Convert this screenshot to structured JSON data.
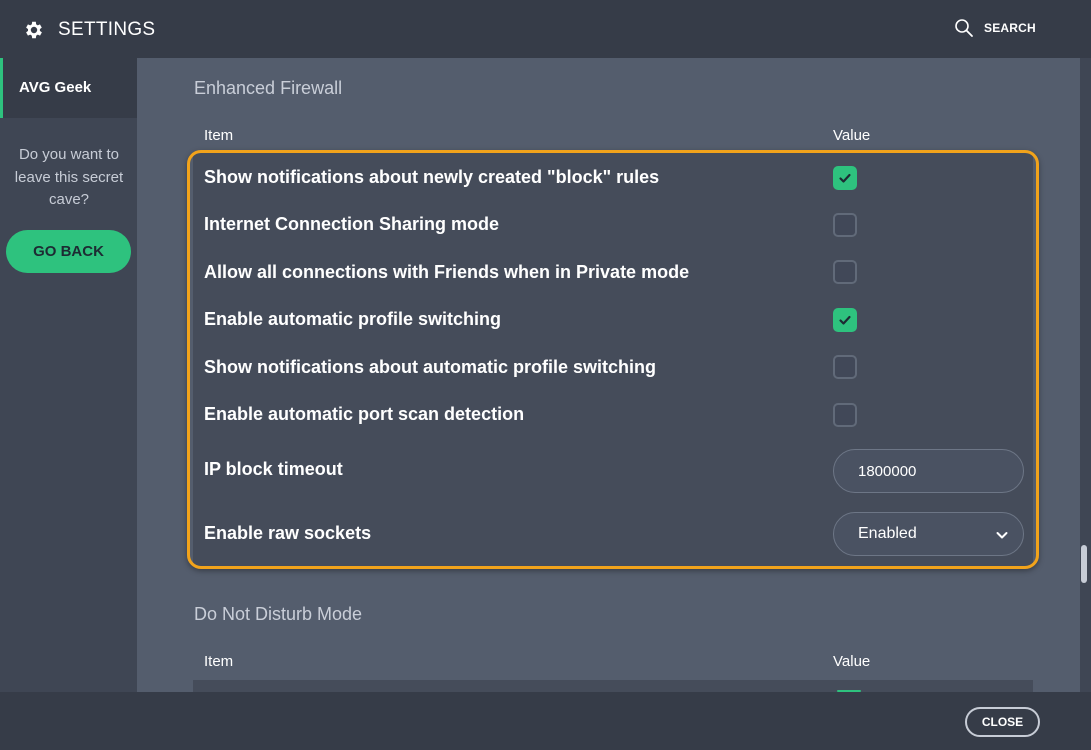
{
  "header": {
    "title": "SETTINGS",
    "search_label": "SEARCH",
    "icons": {
      "settings": "gear-icon",
      "search": "search-icon"
    }
  },
  "sidebar": {
    "active_item": "AVG Geek",
    "prompt": "Do you want to leave this secret cave?",
    "go_back_label": "GO BACK"
  },
  "sections": [
    {
      "title": "Enhanced Firewall",
      "col_item": "Item",
      "col_value": "Value",
      "rows": [
        {
          "label": "Show notifications about newly created \"block\" rules",
          "type": "checkbox",
          "checked": true
        },
        {
          "label": "Internet Connection Sharing mode",
          "type": "checkbox",
          "checked": false
        },
        {
          "label": "Allow all connections with Friends when in Private mode",
          "type": "checkbox",
          "checked": false
        },
        {
          "label": "Enable automatic profile switching",
          "type": "checkbox",
          "checked": true
        },
        {
          "label": "Show notifications about automatic profile switching",
          "type": "checkbox",
          "checked": false
        },
        {
          "label": "Enable automatic port scan detection",
          "type": "checkbox",
          "checked": false
        },
        {
          "label": "IP block timeout",
          "type": "text",
          "value": "1800000"
        },
        {
          "label": "Enable raw sockets",
          "type": "select",
          "value": "Enabled"
        }
      ]
    },
    {
      "title": "Do Not Disturb Mode",
      "col_item": "Item",
      "col_value": "Value"
    }
  ],
  "footer": {
    "close_label": "CLOSE"
  },
  "colors": {
    "accent": "#2ec27e",
    "highlight": "#f2a31b",
    "header_bg": "#363c48",
    "content_bg": "#545d6d"
  }
}
